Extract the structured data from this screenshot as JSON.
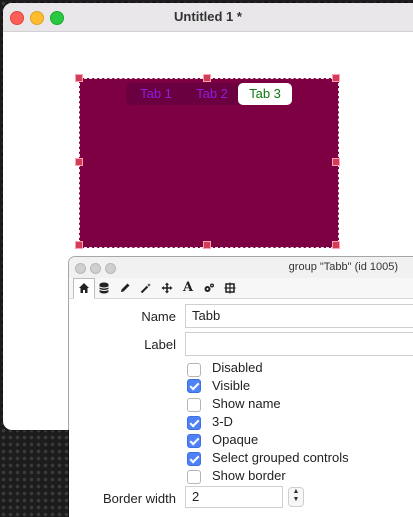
{
  "main_window": {
    "title": "Untitled 1 *",
    "tabs": [
      "Tab 1",
      "Tab 2",
      "Tab 3"
    ],
    "selected_tab": "Tab 3",
    "group_color": "#7c0042"
  },
  "inspector": {
    "title": "group \"Tabb\" (id 1005)",
    "toolbar_icons": [
      "home-icon",
      "database-icon",
      "pencil-icon",
      "magic-wand-icon",
      "move-icon",
      "text-icon",
      "gears-icon",
      "geometry-icon"
    ],
    "name_label": "Name",
    "name_value": "Tabb",
    "label_label": "Label",
    "label_value": "",
    "checkboxes": [
      {
        "label": "Disabled",
        "checked": false
      },
      {
        "label": "Visible",
        "checked": true
      },
      {
        "label": "Show name",
        "checked": false
      },
      {
        "label": "3-D",
        "checked": true
      },
      {
        "label": "Opaque",
        "checked": true
      },
      {
        "label": "Select grouped controls",
        "checked": true
      },
      {
        "label": "Show border",
        "checked": false
      }
    ],
    "border_width_label": "Border width",
    "border_width_value": "2"
  }
}
